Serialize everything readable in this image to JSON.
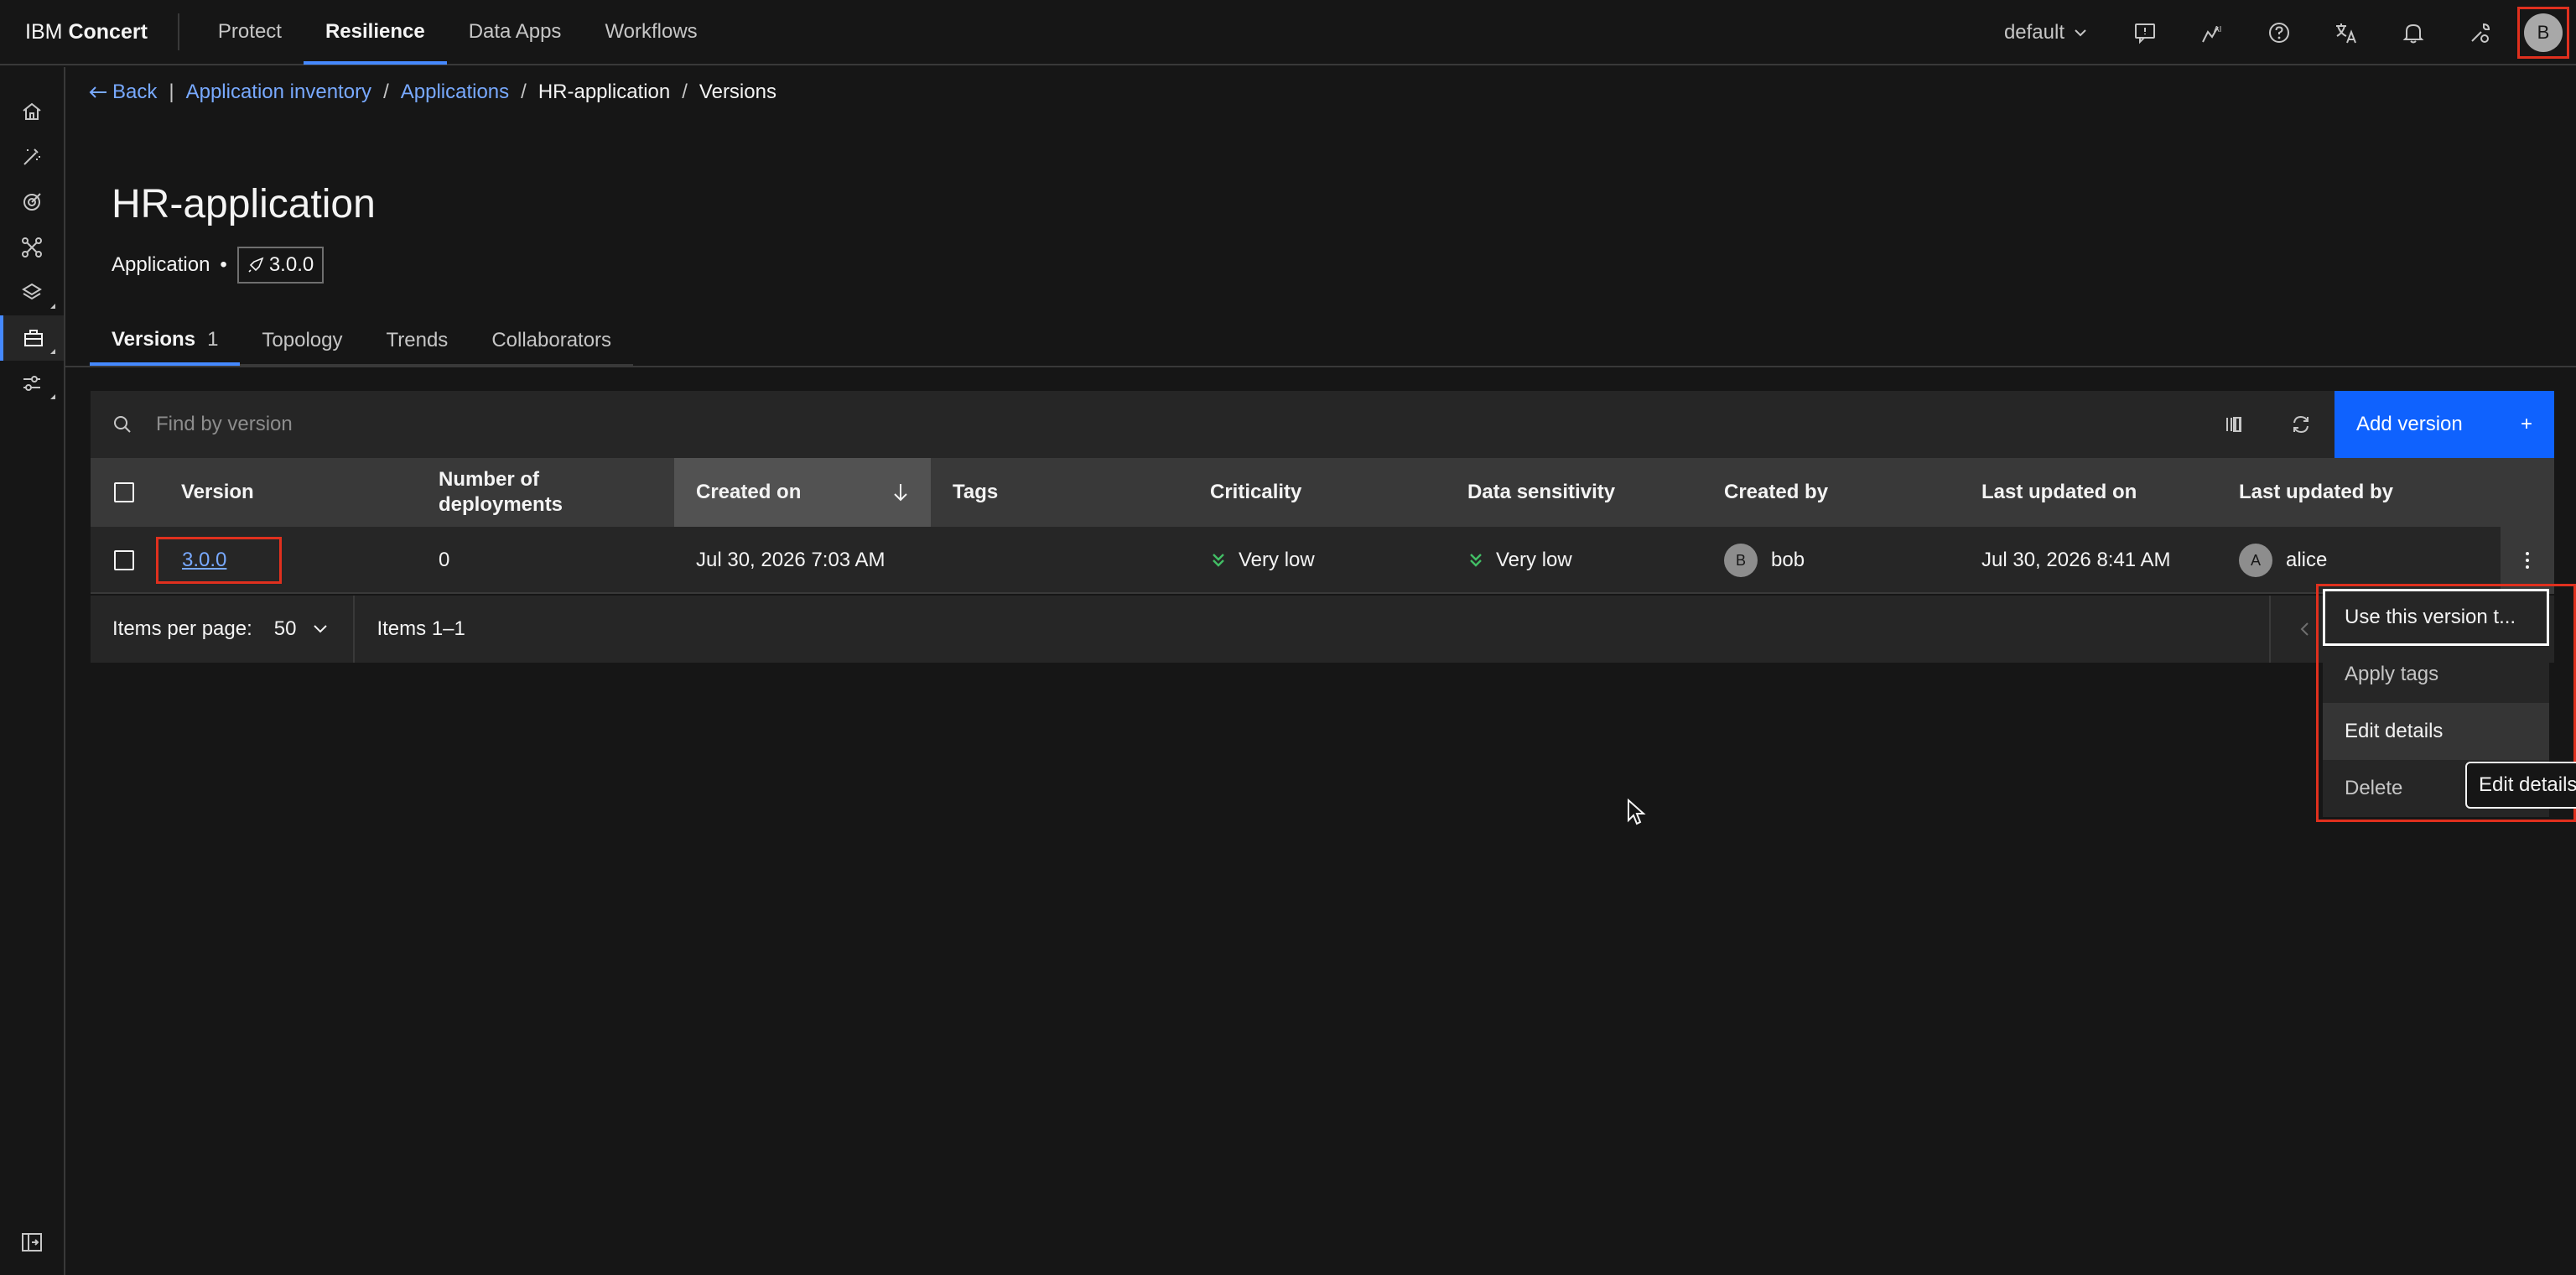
{
  "header": {
    "brand_prefix": "IBM",
    "brand_name": "Concert",
    "nav": [
      "Protect",
      "Resilience",
      "Data Apps",
      "Workflows"
    ],
    "active_nav": "Resilience",
    "tenant": "default",
    "avatar_initial": "B"
  },
  "breadcrumb": {
    "back": "Back",
    "items": [
      "Application inventory",
      "Applications",
      "HR-application",
      "Versions"
    ]
  },
  "page": {
    "title": "HR-application",
    "type": "Application",
    "version_tag": "3.0.0"
  },
  "tabs": [
    {
      "label": "Versions",
      "count": "1"
    },
    {
      "label": "Topology"
    },
    {
      "label": "Trends"
    },
    {
      "label": "Collaborators"
    }
  ],
  "toolbar": {
    "search_placeholder": "Find by version",
    "add_label": "Add version",
    "add_icon": "+"
  },
  "table": {
    "columns": [
      "Version",
      "Number of deployments",
      "Created on",
      "Tags",
      "Criticality",
      "Data sensitivity",
      "Created by",
      "Last updated on",
      "Last updated by"
    ],
    "columns_line2": [
      "",
      "deployments",
      "",
      "",
      "",
      "",
      "",
      "",
      ""
    ],
    "col_number_line1": "Number of",
    "rows": [
      {
        "version": "3.0.0",
        "deployments": "0",
        "created_on": "Jul 30, 2026 7:03 AM",
        "tags": "",
        "criticality": "Very low",
        "data_sensitivity": "Very low",
        "created_by": "bob",
        "created_by_initial": "B",
        "last_updated_on": "Jul 30, 2026 8:41 AM",
        "last_updated_by": "alice",
        "last_updated_by_initial": "A"
      }
    ]
  },
  "pagination": {
    "items_per_page_label": "Items per page:",
    "items_per_page": "50",
    "range": "Items 1–1"
  },
  "overflow_menu": {
    "items": [
      "Use this version t...",
      "Apply tags",
      "Edit details",
      "Delete"
    ],
    "tooltip": "Edit details"
  },
  "colors": {
    "accent": "#0f62fe",
    "link": "#78a9ff",
    "highlight": "#e0301e",
    "low_indicator": "#42be65"
  }
}
